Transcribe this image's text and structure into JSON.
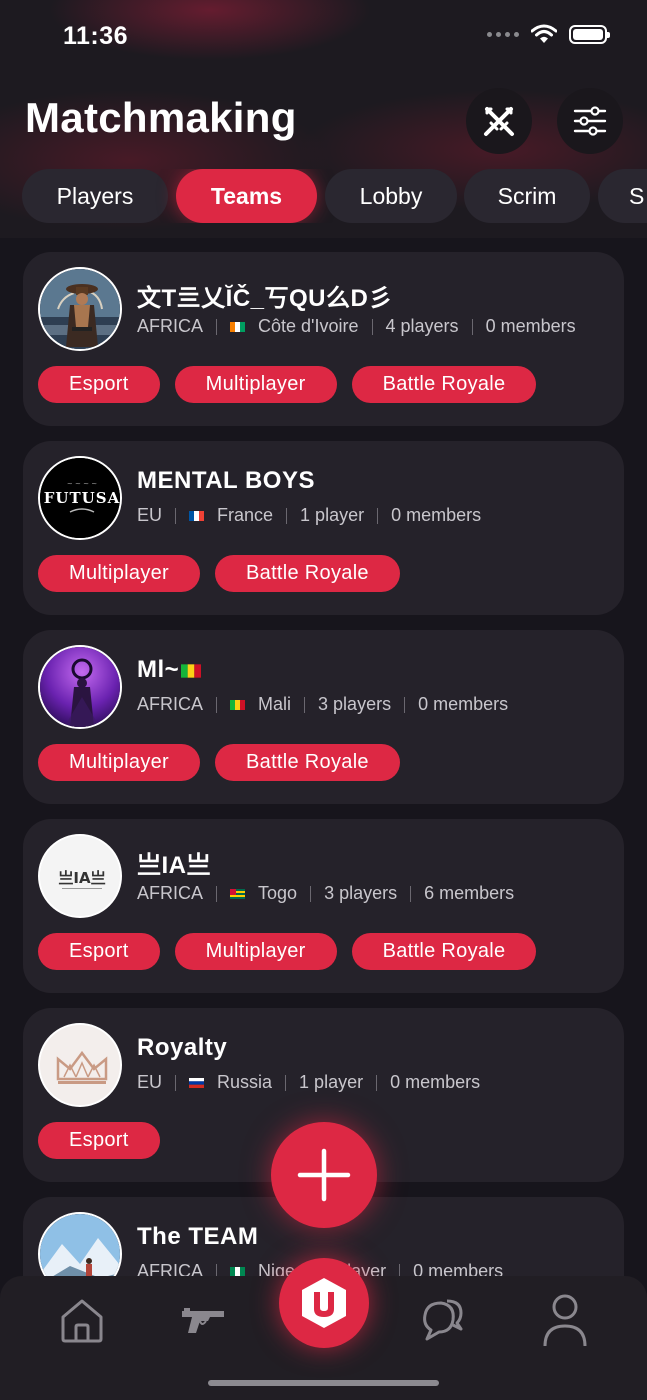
{
  "status_bar": {
    "time": "11:36"
  },
  "header": {
    "title": "Matchmaking"
  },
  "tabs": [
    {
      "label": "Players",
      "active": false
    },
    {
      "label": "Teams",
      "active": true
    },
    {
      "label": "Lobby",
      "active": false
    },
    {
      "label": "Scrim",
      "active": false
    },
    {
      "label": "S",
      "active": false
    }
  ],
  "teams": [
    {
      "name": "文T亖乂ĬČ_丂QU么D彡",
      "region": "AFRICA",
      "country": "Côte d'Ivoire",
      "players": "4 players",
      "members": "0 members",
      "tags": [
        "Esport",
        "Multiplayer",
        "Battle Royale"
      ]
    },
    {
      "name": "MENTAL BOYS",
      "region": "EU",
      "country": "France",
      "players": "1 player",
      "members": "0 members",
      "tags": [
        "Multiplayer",
        "Battle Royale"
      ],
      "avatar_text": "FUTUSA"
    },
    {
      "name": "Ml~",
      "region": "AFRICA",
      "country": "Mali",
      "players": "3 players",
      "members": "0 members",
      "tags": [
        "Multiplayer",
        "Battle Royale"
      ]
    },
    {
      "name": "亗IA亗",
      "region": "AFRICA",
      "country": "Togo",
      "players": "3 players",
      "members": "6 members",
      "tags": [
        "Esport",
        "Multiplayer",
        "Battle Royale"
      ],
      "avatar_text": "亗IA亗"
    },
    {
      "name": "Royalty",
      "region": "EU",
      "country": "Russia",
      "players": "1 player",
      "members": "0 members",
      "tags": [
        "Esport"
      ]
    },
    {
      "name": "The TEAM",
      "region": "AFRICA",
      "country": "Nige",
      "players": "1 player",
      "members": "0 members",
      "tags": []
    }
  ],
  "colors": {
    "accent": "#dd2844",
    "card": "#25222a",
    "background": "#17151c"
  },
  "icons": {
    "header": [
      "swords-icon",
      "filter-sliders-icon"
    ],
    "fab": "plus-icon",
    "tabbar": [
      "home-icon",
      "gun-icon",
      "app-logo-icon",
      "chat-bubbles-icon",
      "profile-icon"
    ]
  }
}
